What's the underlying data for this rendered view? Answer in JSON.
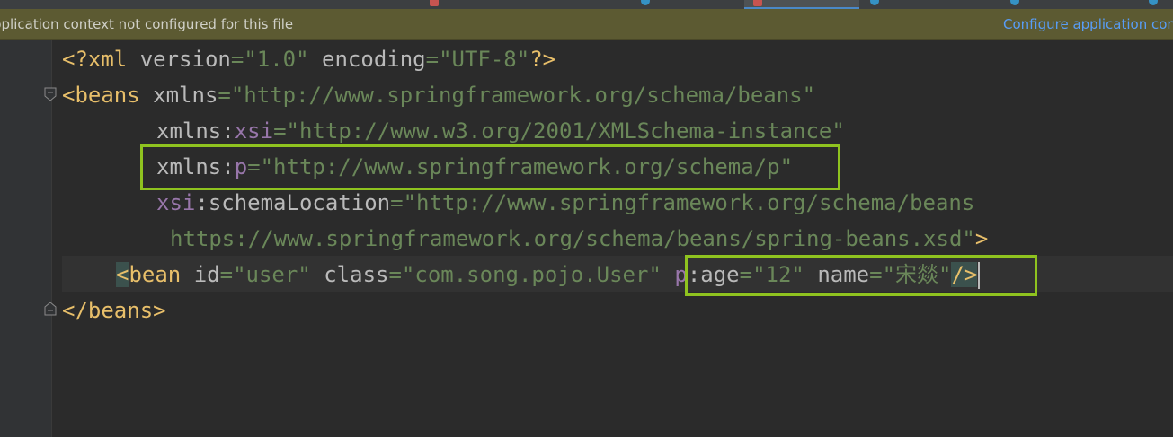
{
  "notification": {
    "message": "pplication context not configured for this file",
    "action_label": "Configure application con"
  },
  "code": {
    "line1": {
      "decl_open": "<?xml ",
      "version_attr": "version",
      "eq1": "=",
      "version_val": "\"1.0\"",
      "space": " ",
      "encoding_attr": "encoding",
      "eq2": "=",
      "encoding_val": "\"UTF-8\"",
      "decl_close": "?>"
    },
    "line2": {
      "open": "<beans ",
      "attr": "xmlns",
      "eq": "=",
      "val": "\"http://www.springframework.org/schema/beans\""
    },
    "line3": {
      "prefix": "xmlns",
      "colon": ":",
      "ns": "xsi",
      "eq": "=",
      "val": "\"http://www.w3.org/2001/XMLSchema-instance\""
    },
    "line4": {
      "prefix": "xmlns",
      "colon": ":",
      "ns": "p",
      "eq": "=",
      "val": "\"http://www.springframework.org/schema/p\""
    },
    "line5": {
      "ns": "xsi",
      "colon": ":",
      "attr": "schemaLocation",
      "eq": "=",
      "val": "\"http://www.springframework.org/schema/beans"
    },
    "line6": {
      "val": "https://www.springframework.org/schema/beans/spring-beans.xsd\"",
      "close": ">"
    },
    "line7": {
      "lt": "<",
      "tag": "bean ",
      "id_attr": "id",
      "eq1": "=",
      "id_val": "\"user\"",
      "sp1": " ",
      "class_attr": "class",
      "eq2": "=",
      "class_val": "\"com.song.pojo.User\"",
      "sp2": " ",
      "p_ns": "p",
      "colon": ":",
      "age_attr": "age",
      "eq3": "=",
      "age_val": "\"12\"",
      "sp3": " ",
      "name_attr": "name",
      "eq4": "=",
      "name_val": "\"宋燚\"",
      "close": "/>"
    },
    "line8": {
      "close_tag": "</beans>"
    }
  },
  "colors": {
    "tag": "#e8bf6a",
    "attribute": "#bababa",
    "namespace": "#9876aa",
    "string": "#6a8759",
    "highlight_box": "#8fc31f",
    "banner_bg": "#5c5a32",
    "link": "#589df6"
  },
  "icons": {
    "fold_open": "fold-open-icon",
    "fold_close": "fold-close-icon"
  }
}
